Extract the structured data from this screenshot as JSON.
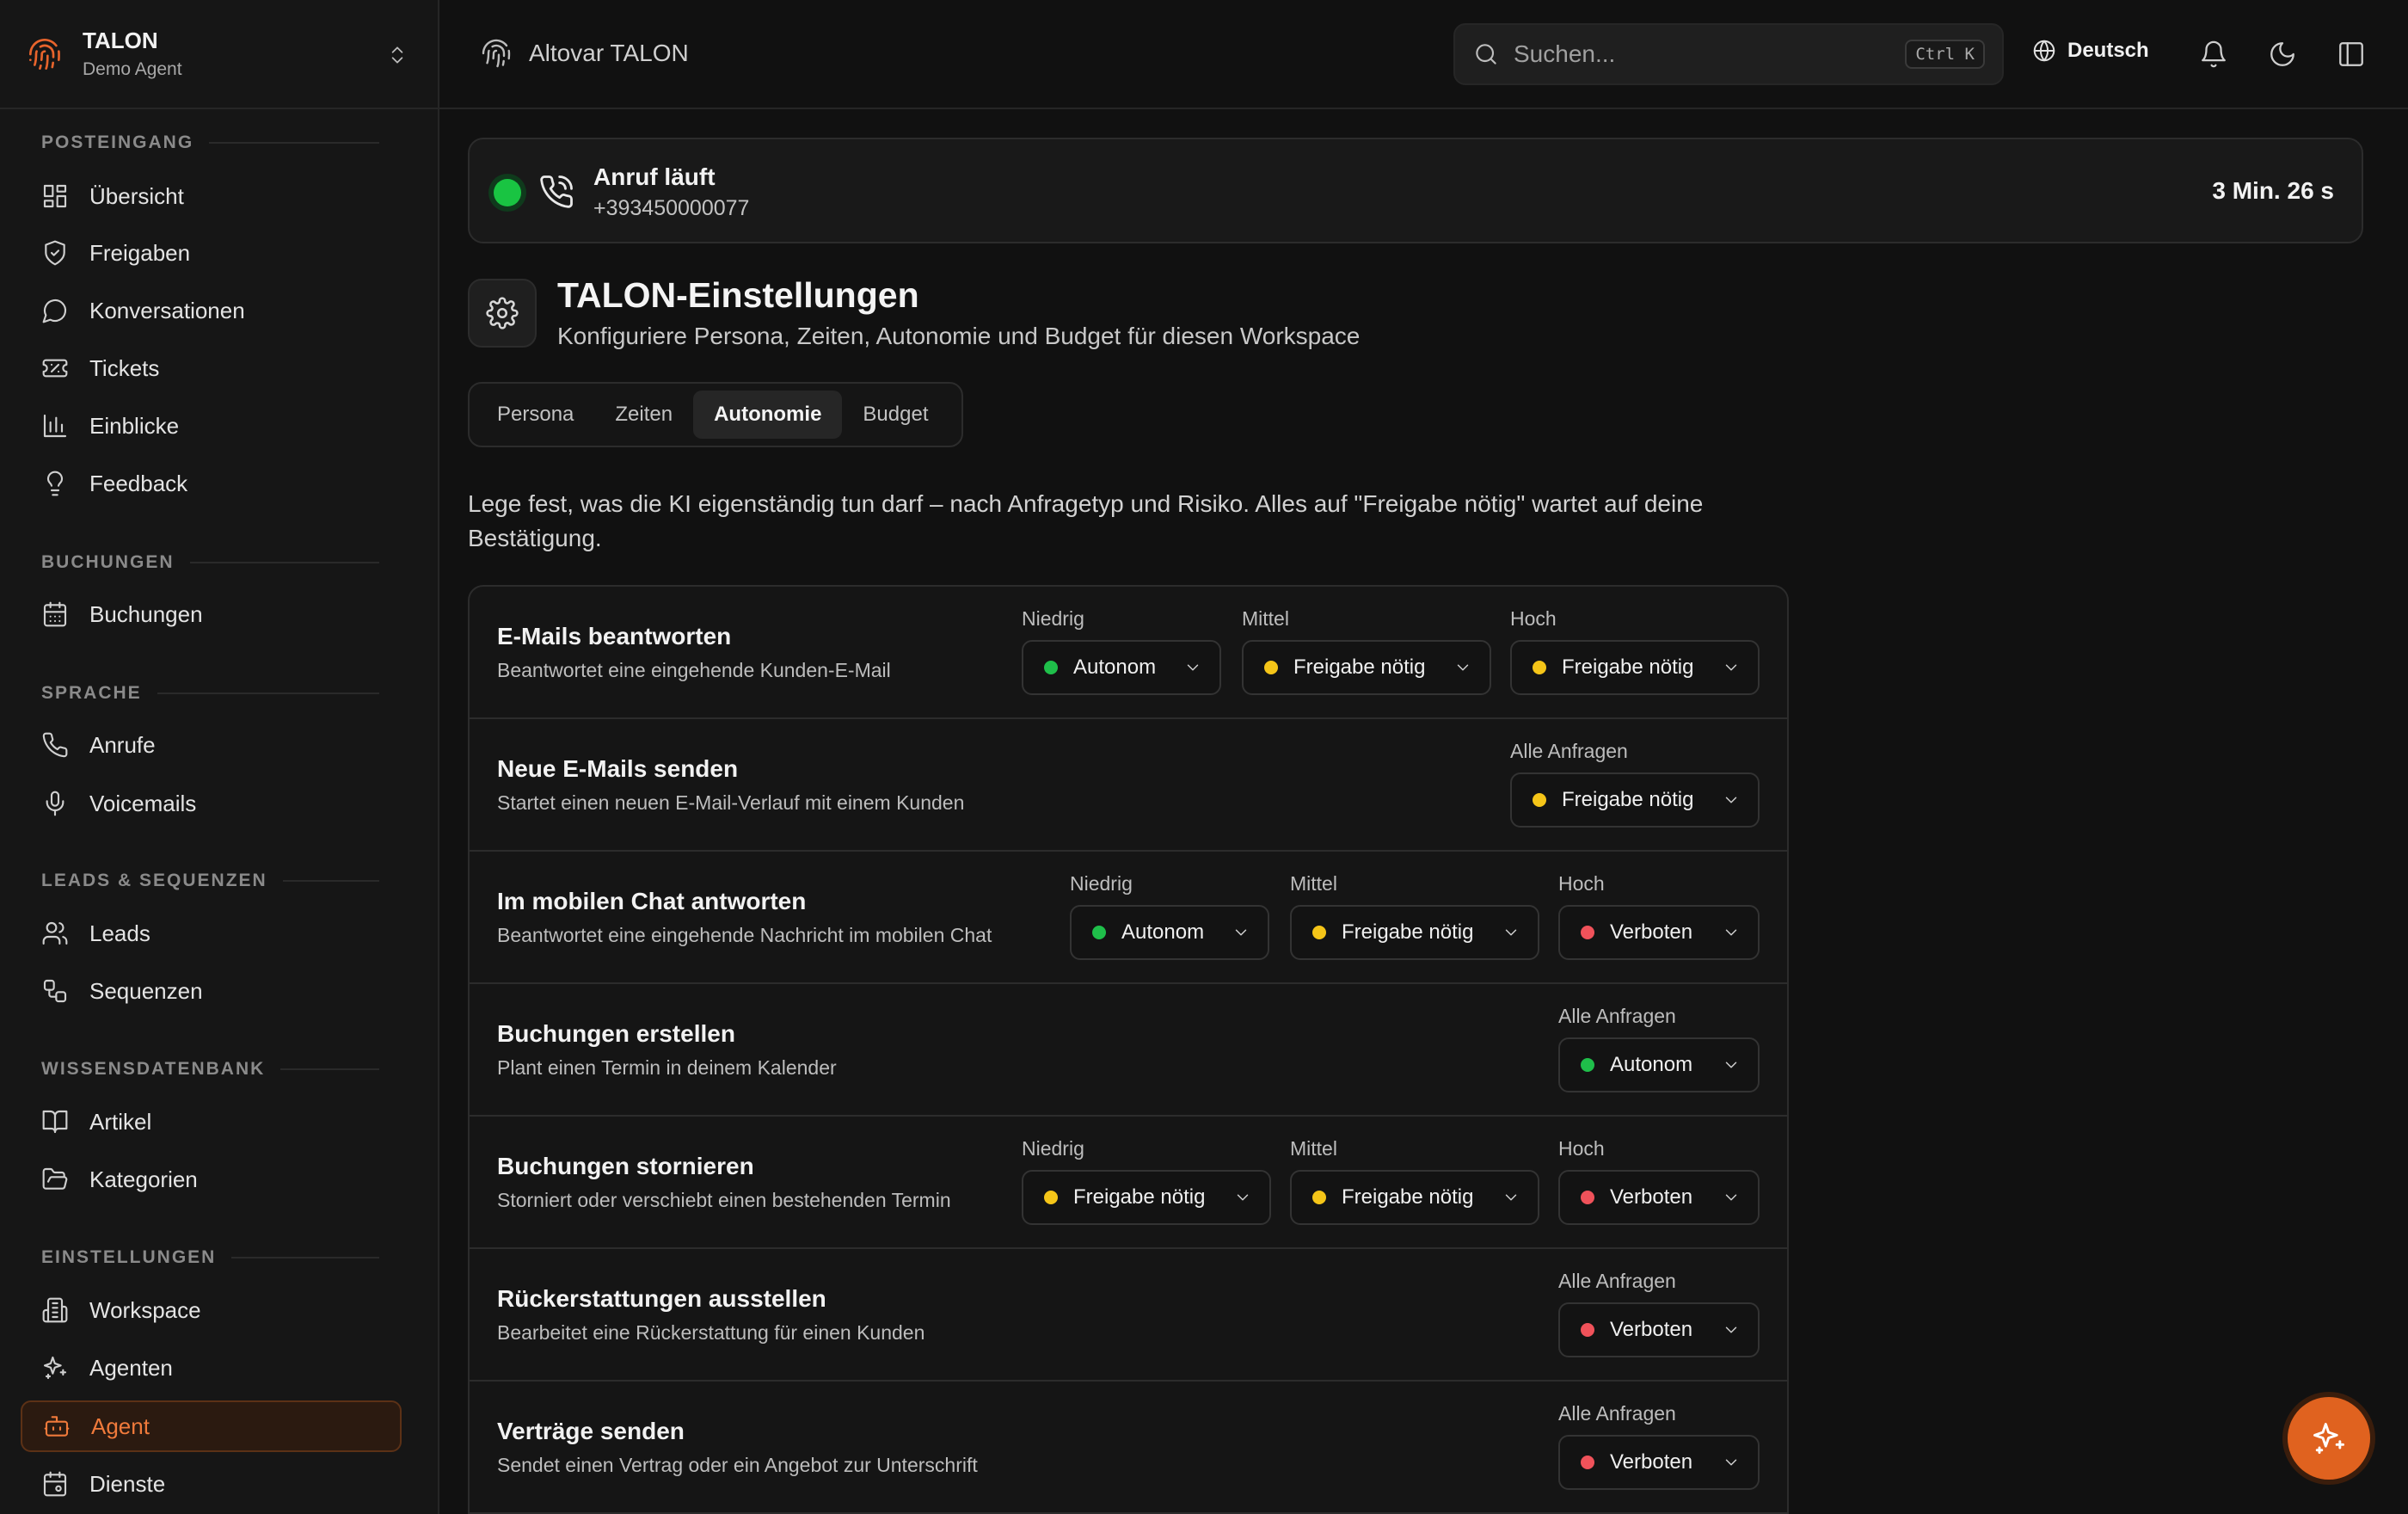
{
  "brand": {
    "title": "TALON",
    "subtitle": "Demo Agent"
  },
  "sidebar": {
    "sections": [
      {
        "title": "POSTEINGANG",
        "items": [
          {
            "label": "Übersicht",
            "icon": "grid-icon"
          },
          {
            "label": "Freigaben",
            "icon": "shield-check-icon"
          },
          {
            "label": "Konversationen",
            "icon": "chat-bubble-icon"
          },
          {
            "label": "Tickets",
            "icon": "ticket-icon"
          },
          {
            "label": "Einblicke",
            "icon": "bar-chart-icon"
          },
          {
            "label": "Feedback",
            "icon": "lightbulb-icon"
          }
        ]
      },
      {
        "title": "BUCHUNGEN",
        "items": [
          {
            "label": "Buchungen",
            "icon": "calendar-icon"
          }
        ]
      },
      {
        "title": "SPRACHE",
        "items": [
          {
            "label": "Anrufe",
            "icon": "phone-icon"
          },
          {
            "label": "Voicemails",
            "icon": "microphone-icon"
          }
        ]
      },
      {
        "title": "LEADS & SEQUENZEN",
        "items": [
          {
            "label": "Leads",
            "icon": "users-icon"
          },
          {
            "label": "Sequenzen",
            "icon": "workflow-icon"
          }
        ]
      },
      {
        "title": "WISSENSDATENBANK",
        "items": [
          {
            "label": "Artikel",
            "icon": "book-open-icon"
          },
          {
            "label": "Kategorien",
            "icon": "folder-open-icon"
          }
        ]
      },
      {
        "title": "EINSTELLUNGEN",
        "items": [
          {
            "label": "Workspace",
            "icon": "building-icon"
          },
          {
            "label": "Agenten",
            "icon": "sparkles-icon"
          },
          {
            "label": "Agent",
            "icon": "bot-icon",
            "active": true
          },
          {
            "label": "Dienste",
            "icon": "calendar-cog-icon"
          }
        ]
      }
    ]
  },
  "topbar": {
    "app_name": "Altovar TALON",
    "search_placeholder": "Suchen...",
    "search_shortcut": "Ctrl K",
    "language": "Deutsch"
  },
  "call": {
    "status": "Anruf läuft",
    "number": "+393450000077",
    "duration": "3 Min. 26 s",
    "status_color": "#19c442"
  },
  "page": {
    "title": "TALON-Einstellungen",
    "subtitle": "Konfiguriere Persona, Zeiten, Autonomie und Budget für diesen Workspace",
    "tabs": [
      "Persona",
      "Zeiten",
      "Autonomie",
      "Budget"
    ],
    "active_tab": "Autonomie",
    "intro": "Lege fest, was die KI eigenständig tun darf – nach Anfragetyp und Risiko. Alles auf \"Freigabe nötig\" wartet auf deine Bestätigung."
  },
  "status_colors": {
    "Autonom": "#1fbf4a",
    "Freigabe nötig": "#f5c518",
    "Verboten": "#f0525a"
  },
  "risk_labels": {
    "low": "Niedrig",
    "mid": "Mittel",
    "high": "Hoch",
    "all": "Alle Anfragen"
  },
  "actions": [
    {
      "title": "E-Mails beantworten",
      "desc": "Beantwortet eine eingehende Kunden-E-Mail",
      "controls": [
        {
          "label": "Niedrig",
          "value": "Autonom"
        },
        {
          "label": "Mittel",
          "value": "Freigabe nötig"
        },
        {
          "label": "Hoch",
          "value": "Freigabe nötig"
        }
      ]
    },
    {
      "title": "Neue E-Mails senden",
      "desc": "Startet einen neuen E-Mail-Verlauf mit einem Kunden",
      "controls": [
        {
          "label": "Alle Anfragen",
          "value": "Freigabe nötig"
        }
      ]
    },
    {
      "title": "Im mobilen Chat antworten",
      "desc": "Beantwortet eine eingehende Nachricht im mobilen Chat",
      "controls": [
        {
          "label": "Niedrig",
          "value": "Autonom"
        },
        {
          "label": "Mittel",
          "value": "Freigabe nötig"
        },
        {
          "label": "Hoch",
          "value": "Verboten"
        }
      ]
    },
    {
      "title": "Buchungen erstellen",
      "desc": "Plant einen Termin in deinem Kalender",
      "controls": [
        {
          "label": "Alle Anfragen",
          "value": "Autonom"
        }
      ]
    },
    {
      "title": "Buchungen stornieren",
      "desc": "Storniert oder verschiebt einen bestehenden Termin",
      "controls": [
        {
          "label": "Niedrig",
          "value": "Freigabe nötig"
        },
        {
          "label": "Mittel",
          "value": "Freigabe nötig"
        },
        {
          "label": "Hoch",
          "value": "Verboten"
        }
      ]
    },
    {
      "title": "Rückerstattungen ausstellen",
      "desc": "Bearbeitet eine Rückerstattung für einen Kunden",
      "controls": [
        {
          "label": "Alle Anfragen",
          "value": "Verboten"
        }
      ]
    },
    {
      "title": "Verträge senden",
      "desc": "Sendet einen Vertrag oder ein Angebot zur Unterschrift",
      "controls": [
        {
          "label": "Alle Anfragen",
          "value": "Verboten"
        }
      ]
    }
  ],
  "fab": {
    "icon": "sparkles-icon"
  }
}
